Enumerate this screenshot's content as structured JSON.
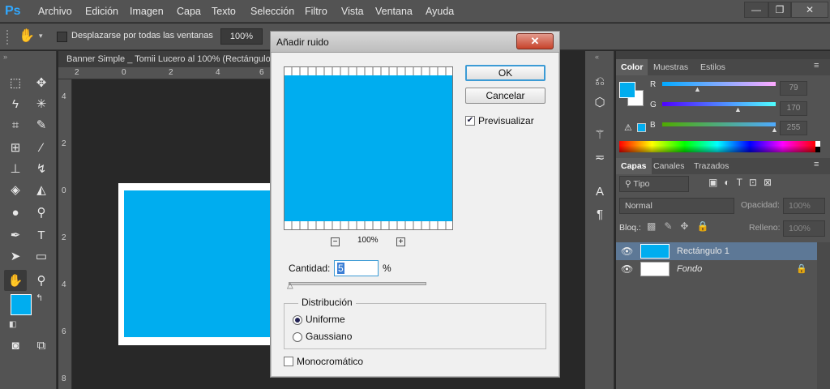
{
  "app": {
    "logo": "Ps"
  },
  "menu": [
    "Archivo",
    "Edición",
    "Imagen",
    "Capa",
    "Texto",
    "Selección",
    "Filtro",
    "Vista",
    "Ventana",
    "Ayuda"
  ],
  "window_controls": {
    "minimize": "—",
    "restore": "❐",
    "close": "✕"
  },
  "options_bar": {
    "tool_icon": "hand-icon",
    "scroll_all_label": "Desplazarse por todas las ventanas",
    "zoom_value": "100%"
  },
  "document": {
    "tab_title": "Banner Simple _ Tomii Lucero al 100% (Rectángulo",
    "ruler_h": [
      "2",
      "0",
      "2",
      "4",
      "6"
    ],
    "ruler_v": [
      "4",
      "2",
      "0",
      "2",
      "4",
      "6",
      "8"
    ],
    "rect_color": "#00adef"
  },
  "dialog": {
    "title": "Añadir ruido",
    "close": "✕",
    "ok": "OK",
    "cancel": "Cancelar",
    "preview_label": "Previsualizar",
    "preview_checked": true,
    "zoom_minus": "−",
    "zoom_plus": "+",
    "zoom_level": "100%",
    "amount_label": "Cantidad:",
    "amount_value": "5",
    "amount_unit": "%",
    "distribution_label": "Distribución",
    "distribution_options": [
      "Uniforme",
      "Gaussiano"
    ],
    "distribution_selected": "Uniforme",
    "mono_label": "Monocromático"
  },
  "color_panel": {
    "tabs": [
      "Color",
      "Muestras",
      "Estilos"
    ],
    "r_label": "R",
    "r_value": "79",
    "g_label": "G",
    "g_value": "170",
    "b_label": "B",
    "b_value": "255",
    "fg_color": "#00adef"
  },
  "layers_panel": {
    "tabs": [
      "Capas",
      "Canales",
      "Trazados"
    ],
    "filter_label": "Tipo",
    "blend_mode": "Normal",
    "opacity_label": "Opacidad:",
    "opacity_value": "100%",
    "lock_label": "Bloq.:",
    "fill_label": "Relleno:",
    "fill_value": "100%",
    "layers": [
      {
        "name": "Rectángulo 1",
        "selected": true
      },
      {
        "name": "Fondo",
        "selected": false,
        "locked": true
      }
    ]
  }
}
